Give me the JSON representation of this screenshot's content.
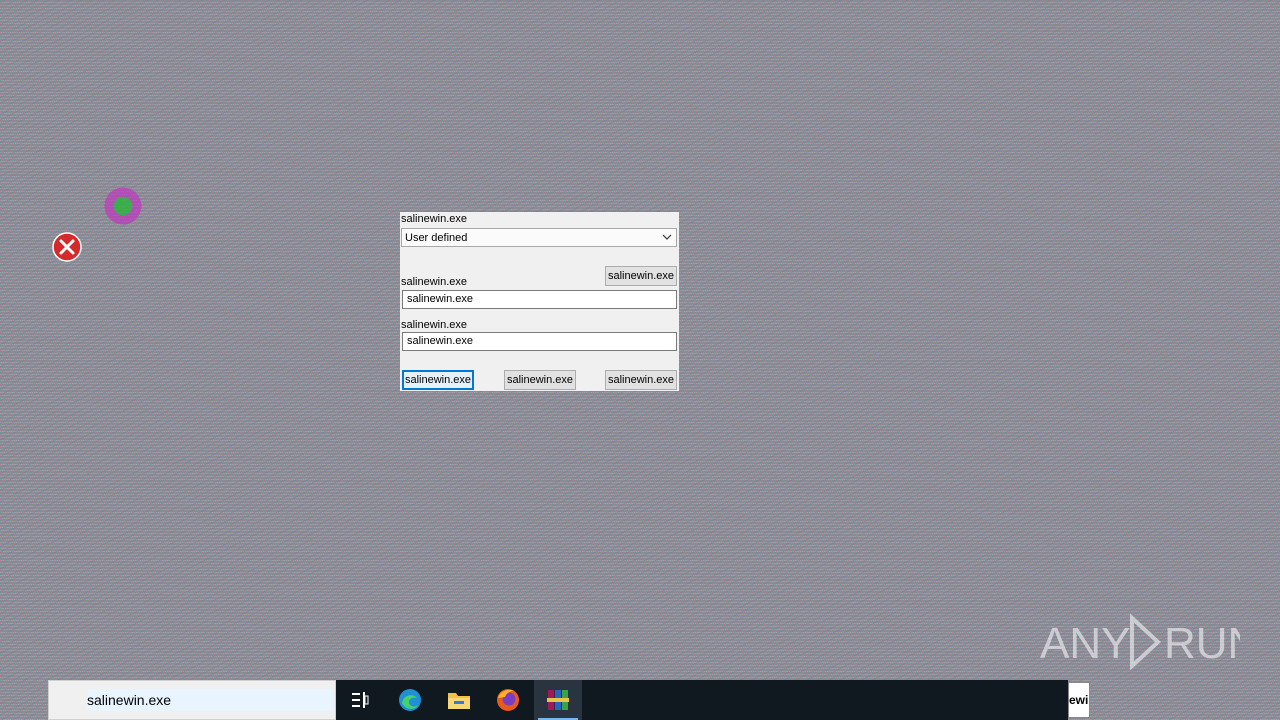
{
  "dialog": {
    "title": "salinewin.exe",
    "combo_value": "User defined",
    "top_button": "salinewin.exe",
    "label1": "salinewin.exe",
    "field1_value": "salinewin.exe",
    "label2": "salinewin.exe",
    "field2_value": "salinewin.exe",
    "buttons": [
      "salinewin.exe",
      "salinewin.exe",
      "salinewin.exe"
    ]
  },
  "taskbar": {
    "search_value": "salinewin.exe",
    "items": [
      "task-view-icon",
      "edge-icon",
      "file-explorer-icon",
      "firefox-icon",
      "winrar-icon"
    ],
    "tray_text": "ewi"
  },
  "watermark": {
    "text": "ANY RUN"
  },
  "colors": {
    "taskbar": "#101820",
    "accent": "#0078d7",
    "dialog_bg": "#f0f0f0"
  }
}
